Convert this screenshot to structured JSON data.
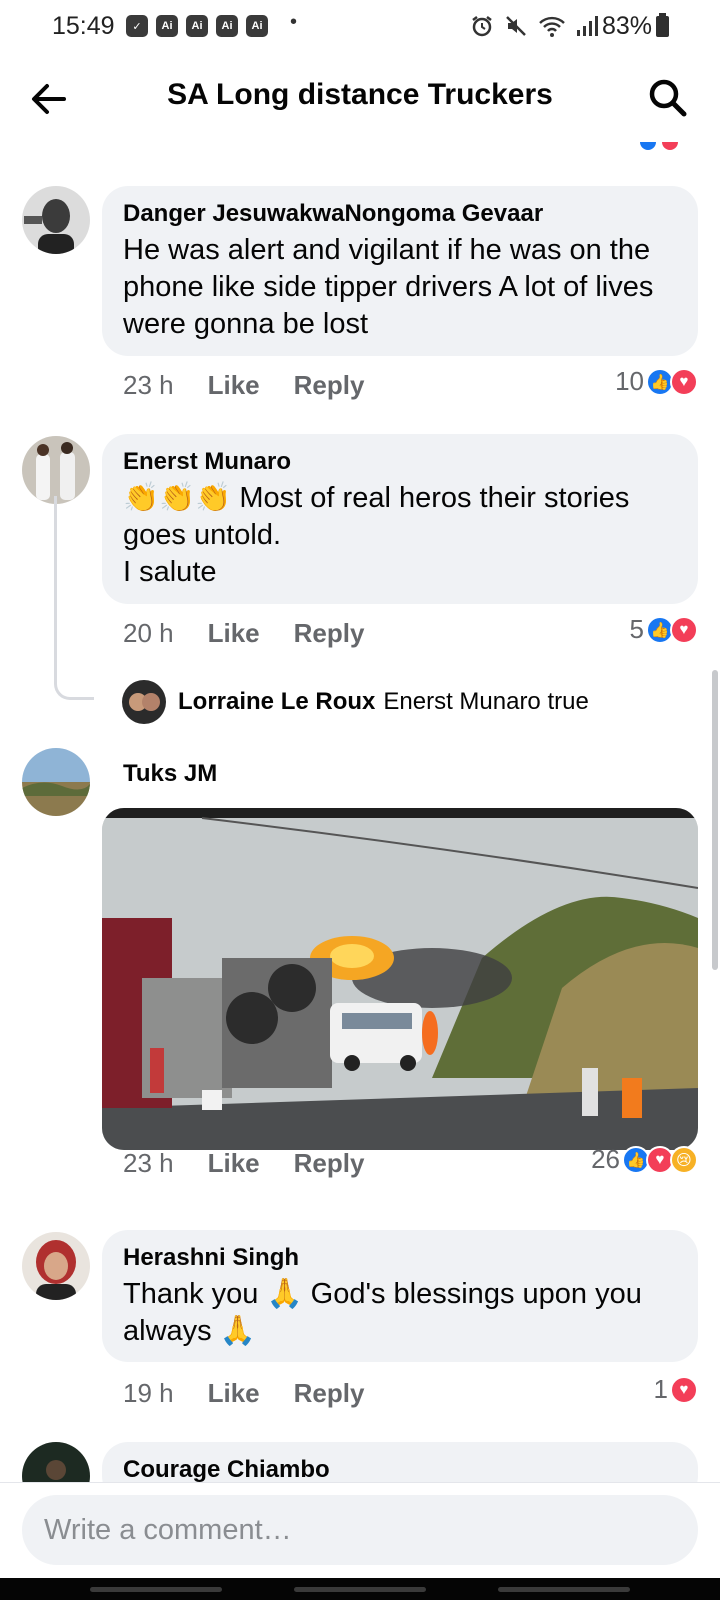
{
  "status_bar": {
    "time": "15:49",
    "app_icons": [
      "Ai",
      "Ai",
      "Ai",
      "Ai"
    ],
    "battery": "83%"
  },
  "header": {
    "title": "SA Long distance Truckers",
    "back_icon": "arrow-left-icon",
    "search_icon": "search-icon"
  },
  "comments": [
    {
      "author": "Danger JesuwakwaNongoma Gevaar",
      "text": "He was alert and vigilant if he was on the phone like side tipper drivers A lot of lives were gonna be lost",
      "time": "23 h",
      "like_label": "Like",
      "reply_label": "Reply",
      "reaction_count": "10",
      "reactions": [
        "like",
        "love"
      ]
    },
    {
      "author": "Enerst Munaro",
      "text_emoji": "👏👏👏",
      "text": "Most of real heros their stories goes untold.",
      "text2": "I salute",
      "time": "20 h",
      "like_label": "Like",
      "reply_label": "Reply",
      "reaction_count": "5",
      "reactions": [
        "like",
        "love"
      ],
      "reply": {
        "author": "Lorraine Le Roux",
        "text": "Enerst Munaro true"
      }
    },
    {
      "author": "Tuks JM",
      "has_photo": true,
      "time": "23 h",
      "like_label": "Like",
      "reply_label": "Reply",
      "reaction_count": "26",
      "reactions": [
        "like",
        "love",
        "sad"
      ]
    },
    {
      "author": "Herashni Singh",
      "text": "Thank you 🙏 God's blessings upon you always 🙏",
      "time": "19 h",
      "like_label": "Like",
      "reply_label": "Reply",
      "reaction_count": "1",
      "reactions": [
        "love"
      ]
    },
    {
      "author": "Courage Chiambo"
    }
  ],
  "composer": {
    "placeholder": "Write a comment…"
  }
}
